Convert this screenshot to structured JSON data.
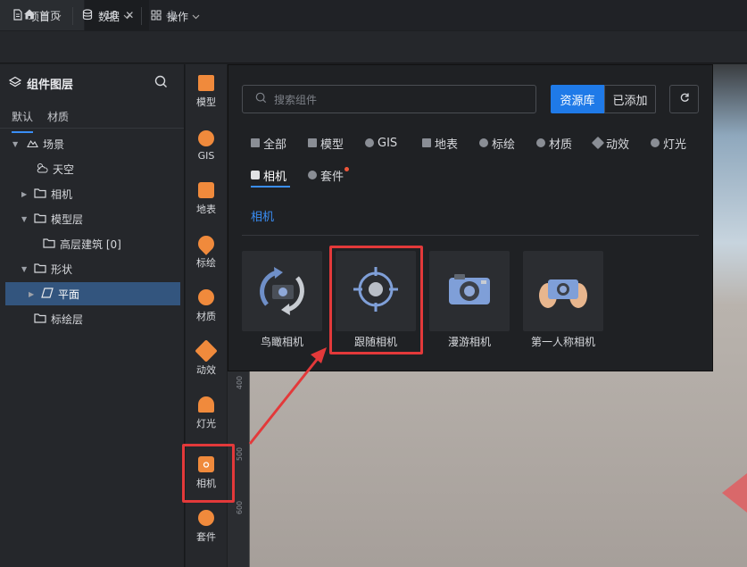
{
  "tabs": {
    "home_label": "首页",
    "active_label": "18",
    "close_glyph": "✕",
    "add_glyph": "+"
  },
  "menubar": {
    "project": "项目",
    "data": "数据",
    "operate": "操作"
  },
  "layer_panel": {
    "title": "组件图层",
    "tabs": [
      "默认",
      "材质"
    ],
    "tree": [
      {
        "label": "场景",
        "expanded": true
      },
      {
        "label": "天空"
      },
      {
        "label": "相机",
        "expanded": false
      },
      {
        "label": "模型层",
        "expanded": true
      },
      {
        "label": "高层建筑 [0]"
      },
      {
        "label": "形状",
        "expanded": true
      },
      {
        "label": "平面",
        "selected": true
      },
      {
        "label": "标绘层"
      }
    ]
  },
  "side_nav": [
    "模型",
    "GIS",
    "地表",
    "标绘",
    "材质",
    "动效",
    "灯光",
    "相机",
    "套件"
  ],
  "component_panel": {
    "search_placeholder": "搜索组件",
    "source_tabs": [
      "资源库",
      "已添加"
    ],
    "categories": [
      "全部",
      "模型",
      "GIS",
      "地表",
      "标绘",
      "材质",
      "动效",
      "灯光",
      "相机",
      "套件"
    ],
    "active_category": "相机",
    "section_title": "相机",
    "items": [
      "鸟瞰相机",
      "跟随相机",
      "漫游相机",
      "第一人称相机"
    ]
  },
  "ruler_ticks": [
    "400",
    "500",
    "600"
  ],
  "colors": {
    "accent": "#1f7ae8",
    "highlight": "#e3393a",
    "icon_orange": "#f08a3c",
    "selection": "#33557e"
  }
}
